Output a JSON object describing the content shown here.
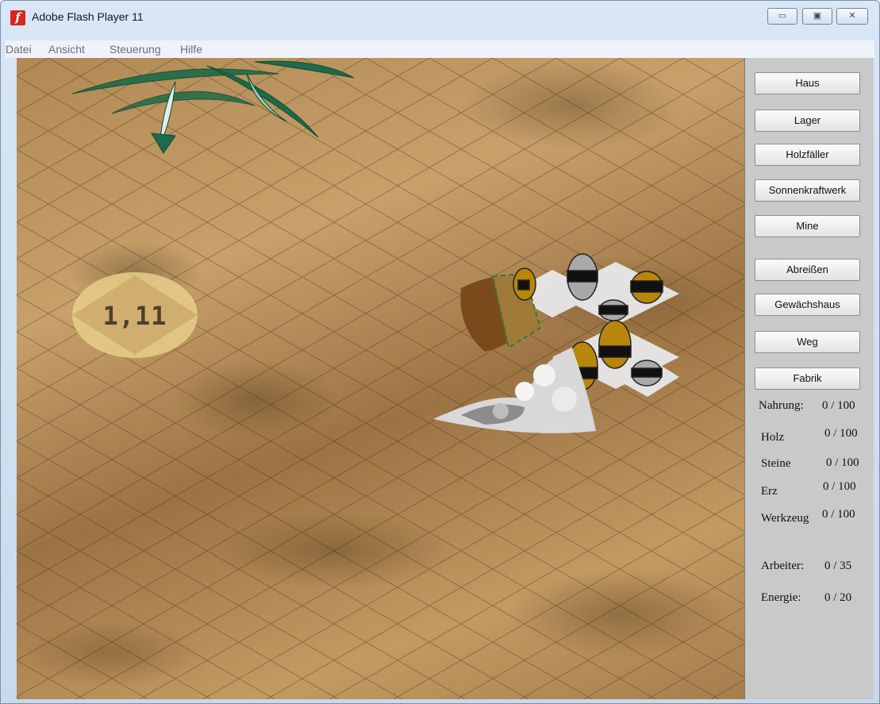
{
  "window": {
    "title": "Adobe Flash Player 11",
    "icon": "flash-player-icon",
    "controls": {
      "minimize": "▭",
      "maximize": "▣",
      "close": "✕"
    }
  },
  "menu": [
    "Datei",
    "Ansicht",
    "Steuerung",
    "Hilfe"
  ],
  "game": {
    "coordinate": "1,11",
    "buttons": [
      "Haus",
      "Lager",
      "Holzfäller",
      "Sonnenkraftwerk",
      "Mine",
      "Abreißen",
      "Gewächshaus",
      "Weg",
      "Fabrik"
    ],
    "resources": [
      {
        "label": "Nahrung:",
        "value": "0 / 100"
      },
      {
        "label": "Holz",
        "value": "0 / 100"
      },
      {
        "label": "Steine",
        "value": "0 / 100"
      },
      {
        "label": "Erz",
        "value": "0 / 100"
      },
      {
        "label": "Werkzeug",
        "value": "0 / 100"
      },
      {
        "label": "Arbeiter:",
        "value": "0 / 35"
      },
      {
        "label": "Energie:",
        "value": "0 / 20"
      }
    ]
  },
  "colors": {
    "sand": "#b08954",
    "panel": "#c9c9c9",
    "worker_amber": "#b8860b",
    "worker_grey": "#a9a9a9"
  }
}
